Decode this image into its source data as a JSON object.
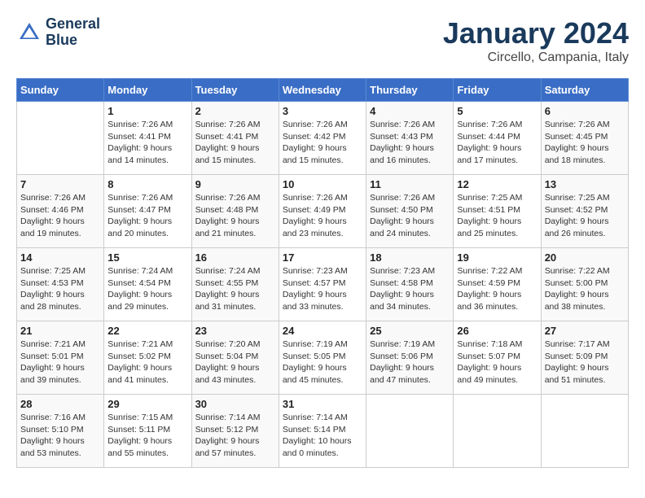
{
  "header": {
    "logo_line1": "General",
    "logo_line2": "Blue",
    "month_title": "January 2024",
    "subtitle": "Circello, Campania, Italy"
  },
  "days_of_week": [
    "Sunday",
    "Monday",
    "Tuesday",
    "Wednesday",
    "Thursday",
    "Friday",
    "Saturday"
  ],
  "weeks": [
    [
      {
        "num": "",
        "info": ""
      },
      {
        "num": "1",
        "info": "Sunrise: 7:26 AM\nSunset: 4:41 PM\nDaylight: 9 hours\nand 14 minutes."
      },
      {
        "num": "2",
        "info": "Sunrise: 7:26 AM\nSunset: 4:41 PM\nDaylight: 9 hours\nand 15 minutes."
      },
      {
        "num": "3",
        "info": "Sunrise: 7:26 AM\nSunset: 4:42 PM\nDaylight: 9 hours\nand 15 minutes."
      },
      {
        "num": "4",
        "info": "Sunrise: 7:26 AM\nSunset: 4:43 PM\nDaylight: 9 hours\nand 16 minutes."
      },
      {
        "num": "5",
        "info": "Sunrise: 7:26 AM\nSunset: 4:44 PM\nDaylight: 9 hours\nand 17 minutes."
      },
      {
        "num": "6",
        "info": "Sunrise: 7:26 AM\nSunset: 4:45 PM\nDaylight: 9 hours\nand 18 minutes."
      }
    ],
    [
      {
        "num": "7",
        "info": "Sunrise: 7:26 AM\nSunset: 4:46 PM\nDaylight: 9 hours\nand 19 minutes."
      },
      {
        "num": "8",
        "info": "Sunrise: 7:26 AM\nSunset: 4:47 PM\nDaylight: 9 hours\nand 20 minutes."
      },
      {
        "num": "9",
        "info": "Sunrise: 7:26 AM\nSunset: 4:48 PM\nDaylight: 9 hours\nand 21 minutes."
      },
      {
        "num": "10",
        "info": "Sunrise: 7:26 AM\nSunset: 4:49 PM\nDaylight: 9 hours\nand 23 minutes."
      },
      {
        "num": "11",
        "info": "Sunrise: 7:26 AM\nSunset: 4:50 PM\nDaylight: 9 hours\nand 24 minutes."
      },
      {
        "num": "12",
        "info": "Sunrise: 7:25 AM\nSunset: 4:51 PM\nDaylight: 9 hours\nand 25 minutes."
      },
      {
        "num": "13",
        "info": "Sunrise: 7:25 AM\nSunset: 4:52 PM\nDaylight: 9 hours\nand 26 minutes."
      }
    ],
    [
      {
        "num": "14",
        "info": "Sunrise: 7:25 AM\nSunset: 4:53 PM\nDaylight: 9 hours\nand 28 minutes."
      },
      {
        "num": "15",
        "info": "Sunrise: 7:24 AM\nSunset: 4:54 PM\nDaylight: 9 hours\nand 29 minutes."
      },
      {
        "num": "16",
        "info": "Sunrise: 7:24 AM\nSunset: 4:55 PM\nDaylight: 9 hours\nand 31 minutes."
      },
      {
        "num": "17",
        "info": "Sunrise: 7:23 AM\nSunset: 4:57 PM\nDaylight: 9 hours\nand 33 minutes."
      },
      {
        "num": "18",
        "info": "Sunrise: 7:23 AM\nSunset: 4:58 PM\nDaylight: 9 hours\nand 34 minutes."
      },
      {
        "num": "19",
        "info": "Sunrise: 7:22 AM\nSunset: 4:59 PM\nDaylight: 9 hours\nand 36 minutes."
      },
      {
        "num": "20",
        "info": "Sunrise: 7:22 AM\nSunset: 5:00 PM\nDaylight: 9 hours\nand 38 minutes."
      }
    ],
    [
      {
        "num": "21",
        "info": "Sunrise: 7:21 AM\nSunset: 5:01 PM\nDaylight: 9 hours\nand 39 minutes."
      },
      {
        "num": "22",
        "info": "Sunrise: 7:21 AM\nSunset: 5:02 PM\nDaylight: 9 hours\nand 41 minutes."
      },
      {
        "num": "23",
        "info": "Sunrise: 7:20 AM\nSunset: 5:04 PM\nDaylight: 9 hours\nand 43 minutes."
      },
      {
        "num": "24",
        "info": "Sunrise: 7:19 AM\nSunset: 5:05 PM\nDaylight: 9 hours\nand 45 minutes."
      },
      {
        "num": "25",
        "info": "Sunrise: 7:19 AM\nSunset: 5:06 PM\nDaylight: 9 hours\nand 47 minutes."
      },
      {
        "num": "26",
        "info": "Sunrise: 7:18 AM\nSunset: 5:07 PM\nDaylight: 9 hours\nand 49 minutes."
      },
      {
        "num": "27",
        "info": "Sunrise: 7:17 AM\nSunset: 5:09 PM\nDaylight: 9 hours\nand 51 minutes."
      }
    ],
    [
      {
        "num": "28",
        "info": "Sunrise: 7:16 AM\nSunset: 5:10 PM\nDaylight: 9 hours\nand 53 minutes."
      },
      {
        "num": "29",
        "info": "Sunrise: 7:15 AM\nSunset: 5:11 PM\nDaylight: 9 hours\nand 55 minutes."
      },
      {
        "num": "30",
        "info": "Sunrise: 7:14 AM\nSunset: 5:12 PM\nDaylight: 9 hours\nand 57 minutes."
      },
      {
        "num": "31",
        "info": "Sunrise: 7:14 AM\nSunset: 5:14 PM\nDaylight: 10 hours\nand 0 minutes."
      },
      {
        "num": "",
        "info": ""
      },
      {
        "num": "",
        "info": ""
      },
      {
        "num": "",
        "info": ""
      }
    ]
  ]
}
